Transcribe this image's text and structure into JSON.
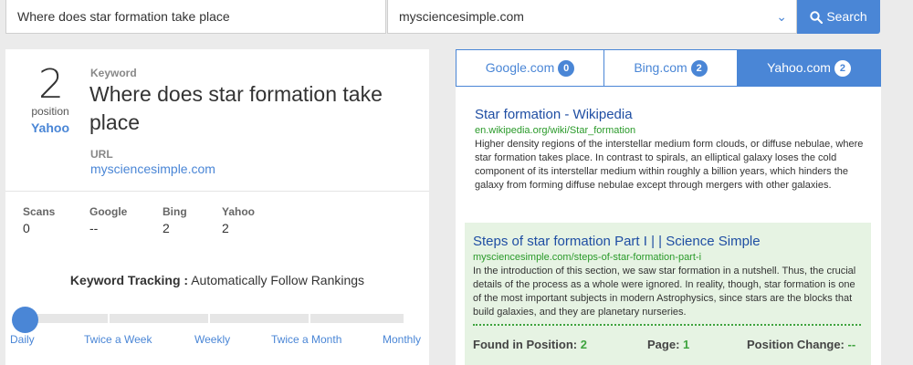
{
  "search": {
    "keyword": "Where does star formation take place",
    "domain": "mysciencesimple.com",
    "button_label": "Search"
  },
  "summary": {
    "position": "2",
    "position_label": "position",
    "engine": "Yahoo",
    "keyword_label": "Keyword",
    "keyword": "Where does star formation take place",
    "url_label": "URL",
    "url": "mysciencesimple.com"
  },
  "stats": [
    {
      "label": "Scans",
      "value": "0"
    },
    {
      "label": "Google",
      "value": "--"
    },
    {
      "label": "Bing",
      "value": "2"
    },
    {
      "label": "Yahoo",
      "value": "2"
    }
  ],
  "tracking": {
    "label": "Keyword Tracking :",
    "value": "Automatically Follow Rankings",
    "frequencies": [
      "Daily",
      "Twice a Week",
      "Weekly",
      "Twice a Month",
      "Monthly"
    ],
    "selected": "Daily"
  },
  "tabs": [
    {
      "label": "Google.com",
      "count": "0",
      "active": false
    },
    {
      "label": "Bing.com",
      "count": "2",
      "active": false
    },
    {
      "label": "Yahoo.com",
      "count": "2",
      "active": true
    }
  ],
  "results": [
    {
      "title": "Star formation - Wikipedia",
      "url": "en.wikipedia.org/wiki/Star_formation",
      "desc": "Higher density regions of the interstellar medium form clouds, or diffuse nebulae, where star formation takes place. In contrast to spirals, an elliptical galaxy loses the cold component of its interstellar medium within roughly a billion years, which hinders the galaxy from forming diffuse nebulae except through mergers with other galaxies."
    },
    {
      "title": "Steps of star formation Part I | | Science Simple",
      "url": "mysciencesimple.com/steps-of-star-formation-part-i",
      "desc": "In the introduction of this section, we saw star formation in a nutshell. Thus, the crucial details of the process as a whole were ignored. In reality, though, star formation is one of the most important subjects in modern Astrophysics, since stars are the blocks that build galaxies, and they are planetary nurseries."
    }
  ],
  "match": {
    "found_label": "Found in Position:",
    "found_value": "2",
    "page_label": "Page:",
    "page_value": "1",
    "change_label": "Position Change:",
    "change_value": "--"
  },
  "colors": {
    "accent": "#4a86d6",
    "highlight_bg": "#e6f3e3",
    "green": "#3ea33e"
  }
}
